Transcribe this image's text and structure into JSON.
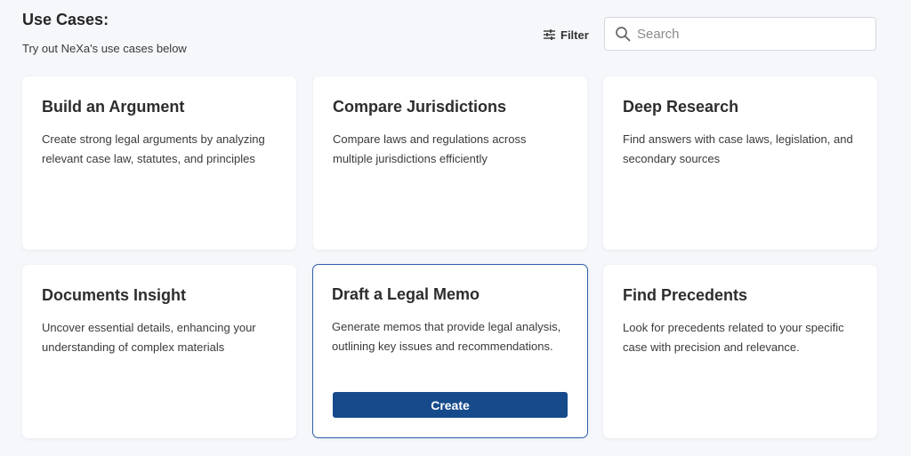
{
  "header": {
    "title": "Use Cases:",
    "subtitle": "Try out NeXa's use cases below",
    "filter_label": "Filter",
    "filter_icon": "sliders-icon",
    "search_placeholder": "Search",
    "search_value": "",
    "search_icon": "magnifier-icon"
  },
  "cards": [
    {
      "title": "Build an Argument",
      "description": "Create strong legal arguments by analyzing relevant case law, statutes, and principles"
    },
    {
      "title": "Compare Jurisdictions",
      "description": "Compare laws and regulations across multiple jurisdictions efficiently"
    },
    {
      "title": "Deep Research",
      "description": "Find answers with case laws, legislation, and secondary sources"
    },
    {
      "title": "Documents Insight",
      "description": "Uncover essential details, enhancing your understanding of complex materials"
    },
    {
      "title": "Draft a Legal Memo",
      "description": "Generate memos that provide legal analysis, outlining key issues and recommendations.",
      "button_label": "Create",
      "selected": true
    },
    {
      "title": "Find Precedents",
      "description": "Look for precedents related to your specific case with precision and relevance."
    }
  ],
  "colors": {
    "background": "#f5f7fb",
    "accent": "#164a8b",
    "selected_border": "#2f5fa7"
  }
}
